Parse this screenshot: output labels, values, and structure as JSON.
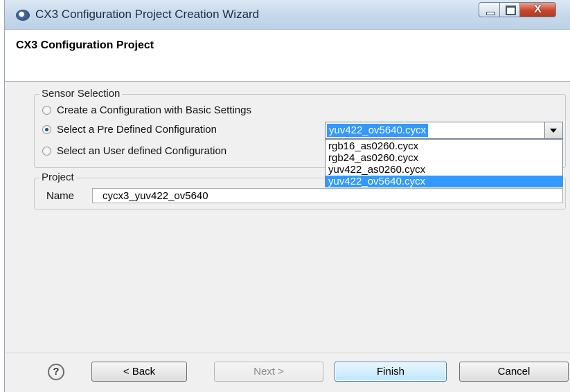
{
  "window": {
    "title": "CX3 Configuration Project Creation Wizard",
    "close_glyph": "X"
  },
  "banner": {
    "title": "CX3 Configuration Project"
  },
  "sensor_selection": {
    "label": "Sensor Selection",
    "options": [
      {
        "label": "Create a Configuration with Basic Settings",
        "checked": false
      },
      {
        "label": "Select a Pre Defined Configuration",
        "checked": true
      },
      {
        "label": "Select an User defined Configuration",
        "checked": false
      }
    ],
    "combo": {
      "value": "yuv422_ov5640.cycx",
      "items": [
        "rgb16_as0260.cycx",
        "rgb24_as0260.cycx",
        "yuv422_as0260.cycx",
        "yuv422_ov5640.cycx"
      ],
      "selected_index": 3
    }
  },
  "project": {
    "label": "Project",
    "name_label": "Name",
    "name_value": "cycx3_yuv422_ov5640"
  },
  "buttons": {
    "help": "?",
    "back": "< Back",
    "next": "Next >",
    "finish": "Finish",
    "cancel": "Cancel"
  },
  "colors": {
    "selection": "#3399ff",
    "close_button": "#c9462c"
  }
}
